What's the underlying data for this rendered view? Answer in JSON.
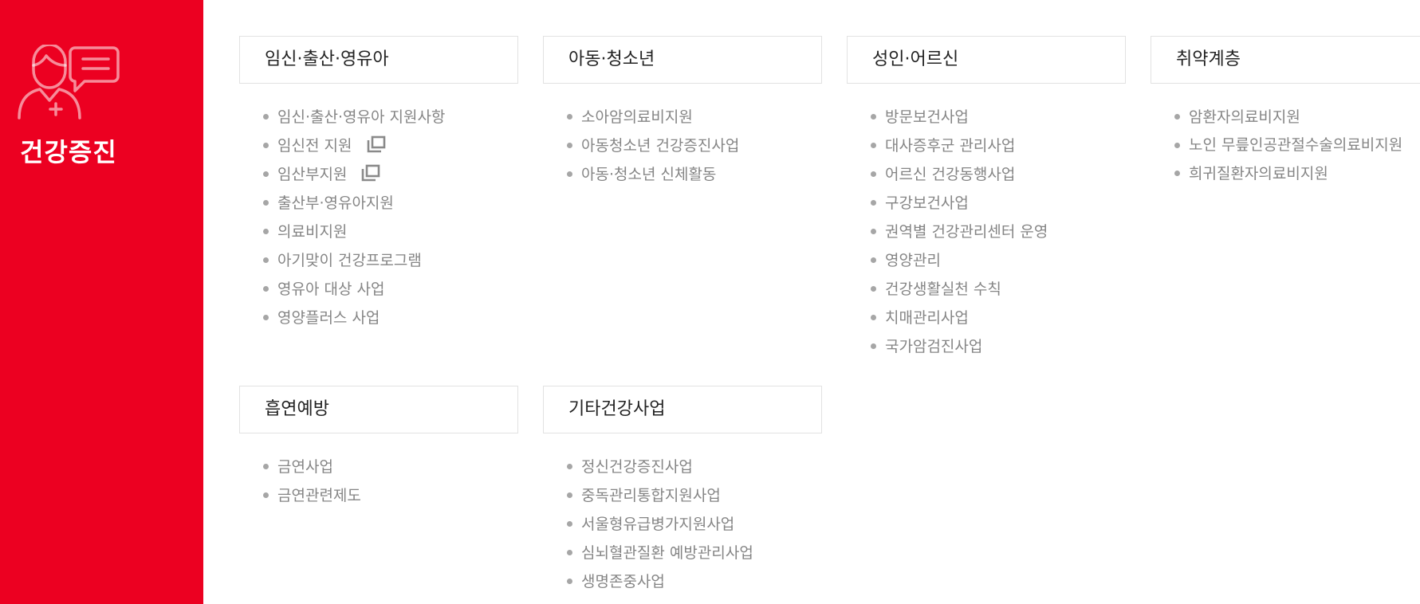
{
  "sidebar": {
    "title": "건강증진",
    "icon": "doctor-chat-icon",
    "background": "#ec0021"
  },
  "groups": [
    {
      "title": "임신·출산·영유아",
      "items": [
        {
          "label": "임신·출산·영유아 지원사항"
        },
        {
          "label": "임신전 지원",
          "icon": "new-window-icon"
        },
        {
          "label": "임산부지원",
          "icon": "new-window-icon"
        },
        {
          "label": "출산부·영유아지원"
        },
        {
          "label": "의료비지원"
        },
        {
          "label": "아기맞이 건강프로그램"
        },
        {
          "label": "영유아 대상 사업"
        },
        {
          "label": "영양플러스 사업"
        }
      ]
    },
    {
      "title": "아동·청소년",
      "items": [
        {
          "label": "소아암의료비지원"
        },
        {
          "label": "아동청소년 건강증진사업"
        },
        {
          "label": "아동·청소년 신체활동"
        }
      ]
    },
    {
      "title": "성인·어르신",
      "items": [
        {
          "label": "방문보건사업"
        },
        {
          "label": "대사증후군 관리사업"
        },
        {
          "label": "어르신 건강동행사업"
        },
        {
          "label": "구강보건사업"
        },
        {
          "label": "권역별 건강관리센터 운영"
        },
        {
          "label": "영양관리"
        },
        {
          "label": "건강생활실천 수칙"
        },
        {
          "label": "치매관리사업"
        },
        {
          "label": "국가암검진사업"
        }
      ]
    },
    {
      "title": "취약계층",
      "items": [
        {
          "label": "암환자의료비지원"
        },
        {
          "label": "노인 무릎인공관절수술의료비지원"
        },
        {
          "label": "희귀질환자의료비지원"
        }
      ]
    },
    {
      "title": "흡연예방",
      "items": [
        {
          "label": "금연사업"
        },
        {
          "label": "금연관련제도"
        }
      ]
    },
    {
      "title": "기타건강사업",
      "items": [
        {
          "label": "정신건강증진사업"
        },
        {
          "label": "중독관리통합지원사업"
        },
        {
          "label": "서울형유급병가지원사업"
        },
        {
          "label": "심뇌혈관질환 예방관리사업"
        },
        {
          "label": "생명존중사업"
        }
      ]
    }
  ]
}
